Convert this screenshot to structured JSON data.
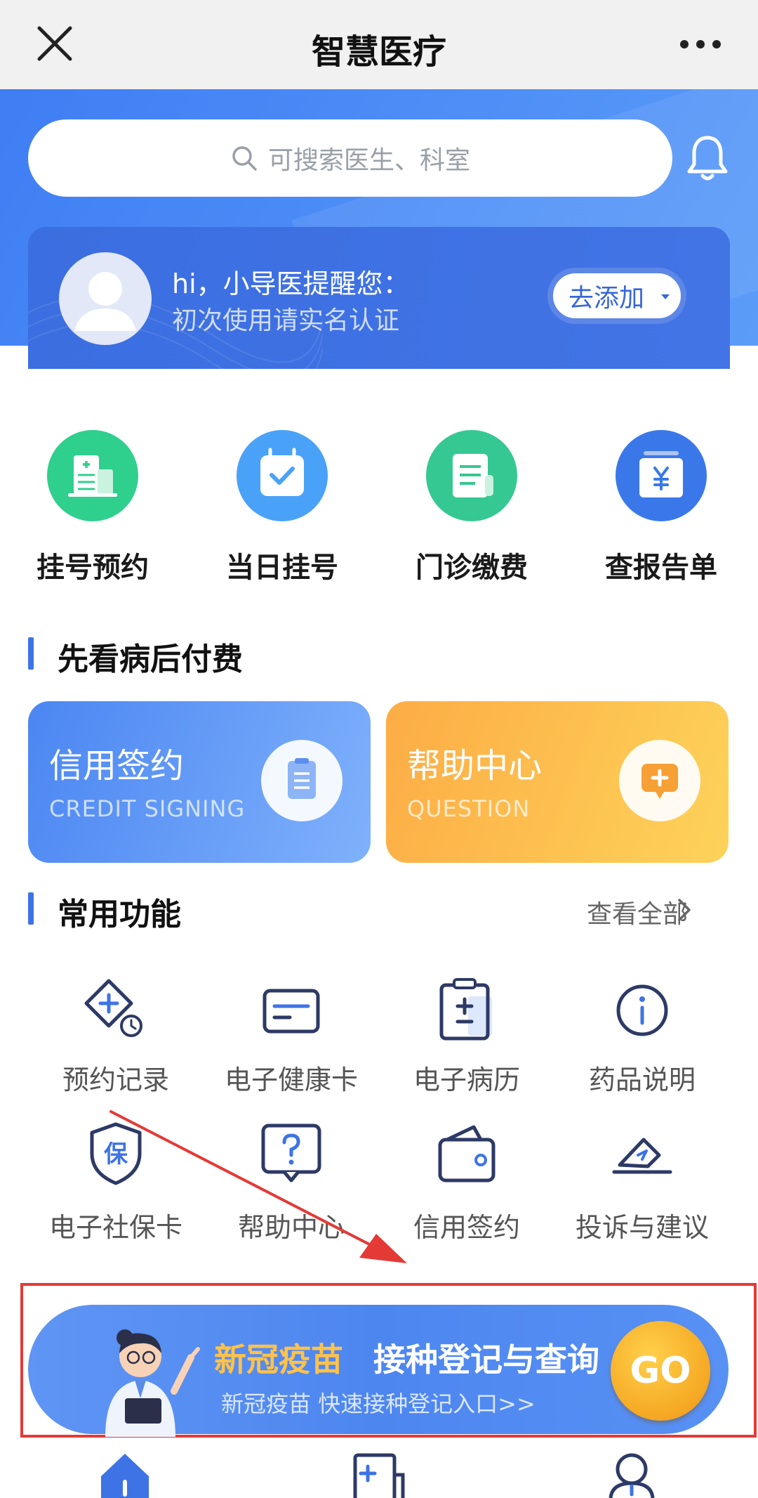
{
  "app": {
    "title": "智慧医疗"
  },
  "search": {
    "placeholder": "可搜索医生、科室"
  },
  "reminder": {
    "greeting": "hi，小导医提醒您：",
    "message": "初次使用请实名认证",
    "button": "去添加"
  },
  "quick_actions": [
    {
      "label": "挂号预约",
      "icon": "hospital-icon",
      "color": "#2fcf8d"
    },
    {
      "label": "当日挂号",
      "icon": "calendar-check-icon",
      "color": "#49a2f7"
    },
    {
      "label": "门诊缴费",
      "icon": "receipt-icon",
      "color": "#36c892"
    },
    {
      "label": "查报告单",
      "icon": "yen-report-icon",
      "color": "#3a78ea"
    }
  ],
  "section_pay_later": {
    "title": "先看病后付费"
  },
  "promos": [
    {
      "title": "信用签约",
      "subtitle": "CREDIT SIGNING",
      "icon": "clipboard-icon"
    },
    {
      "title": "帮助中心",
      "subtitle": "QUESTION",
      "icon": "chat-plus-icon"
    }
  ],
  "section_common": {
    "title": "常用功能",
    "view_all": "查看全部"
  },
  "features": [
    {
      "label": "预约记录",
      "icon": "appointment-record-icon"
    },
    {
      "label": "电子健康卡",
      "icon": "health-card-icon"
    },
    {
      "label": "电子病历",
      "icon": "medical-record-icon"
    },
    {
      "label": "药品说明",
      "icon": "info-icon"
    },
    {
      "label": "电子社保卡",
      "icon": "social-security-shield-icon"
    },
    {
      "label": "帮助中心",
      "icon": "help-question-icon"
    },
    {
      "label": "信用签约",
      "icon": "wallet-icon"
    },
    {
      "label": "投诉与建议",
      "icon": "eraser-feedback-icon"
    }
  ],
  "banner": {
    "title_highlight": "新冠疫苗",
    "title_rest": "接种登记与查询",
    "subtitle": "新冠疫苗 快速接种登记入口>>",
    "button": "GO"
  },
  "colors": {
    "brand_blue": "#3e73e6",
    "annotation_red": "#e43a36",
    "go_orange": "#f5a823"
  }
}
